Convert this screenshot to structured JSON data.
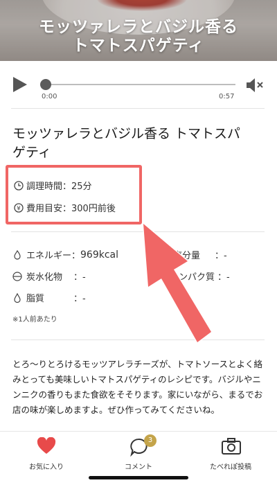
{
  "hero": {
    "title": "モッツァレラとバジル香る\nトマトスパゲティ"
  },
  "player": {
    "current_time": "0:00",
    "duration": "0:57",
    "progress": 0,
    "icons": [
      "play-icon",
      "mute-icon"
    ]
  },
  "recipe": {
    "title": "モッツァレラとバジル香る トマトスパゲティ"
  },
  "info": {
    "cook_time": "調理時間：25分",
    "cost": "費用目安：300円前後",
    "icons": [
      "clock-icon",
      "yen-icon"
    ],
    "highlight_color": "#f06665"
  },
  "nutrition": {
    "energy_label": "エネルギー：",
    "energy_value": "969kcal",
    "salt_label": "塩分量",
    "salt_value": "：-",
    "carbs_label": "炭水化物",
    "carbs_value": "：-",
    "protein_label": "ンパク質",
    "protein_value": "：-",
    "fat_label": "脂質",
    "fat_value": "：-",
    "note": "※1人前あたり"
  },
  "description": {
    "text": "とろ〜りとろけるモッツアレラチーズが、トマトソースとよく絡みとっても美味しいトマトスパゲティのレシピです。バジルやニンニクの香りもまた食欲をそそります。家にいながら、まるでお店の味が楽しめますよ。ぜひ作ってみてくださいね。"
  },
  "bottom_nav": {
    "favorite_label": "お気に入り",
    "comment_label": "コメント",
    "comment_count": "3",
    "post_label": "たべれぽ投稿",
    "favorite_color": "#e84a4a"
  }
}
